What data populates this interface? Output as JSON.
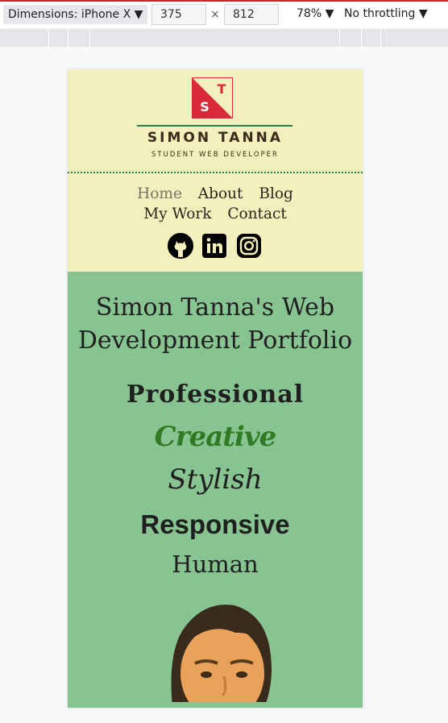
{
  "devtools": {
    "device_label": "Dimensions: iPhone X",
    "width_value": "375",
    "height_value": "812",
    "times_symbol": "×",
    "zoom_label": "78%",
    "throttle_label": "No throttling",
    "dropdown_glyph": "▼"
  },
  "site": {
    "logo": {
      "letter_top": "T",
      "letter_bottom": "S"
    },
    "name": "SIMON TANNA",
    "tagline": "STUDENT WEB DEVELOPER",
    "nav": [
      "Home",
      "About",
      "Blog",
      "My Work",
      "Contact"
    ],
    "socials": [
      "github-icon",
      "linkedin-icon",
      "instagram-icon"
    ]
  },
  "hero": {
    "title": "Simon Tanna's Web Development Portfolio",
    "words": [
      "Professional",
      "Creative",
      "Stylish",
      "Responsive",
      "Human"
    ]
  },
  "colors": {
    "header_bg": "#f3efbe",
    "hero_bg": "#88c491",
    "accent_green": "#2e7d4f",
    "logo_red": "#d8283a",
    "creative_green": "#2f7a22"
  }
}
